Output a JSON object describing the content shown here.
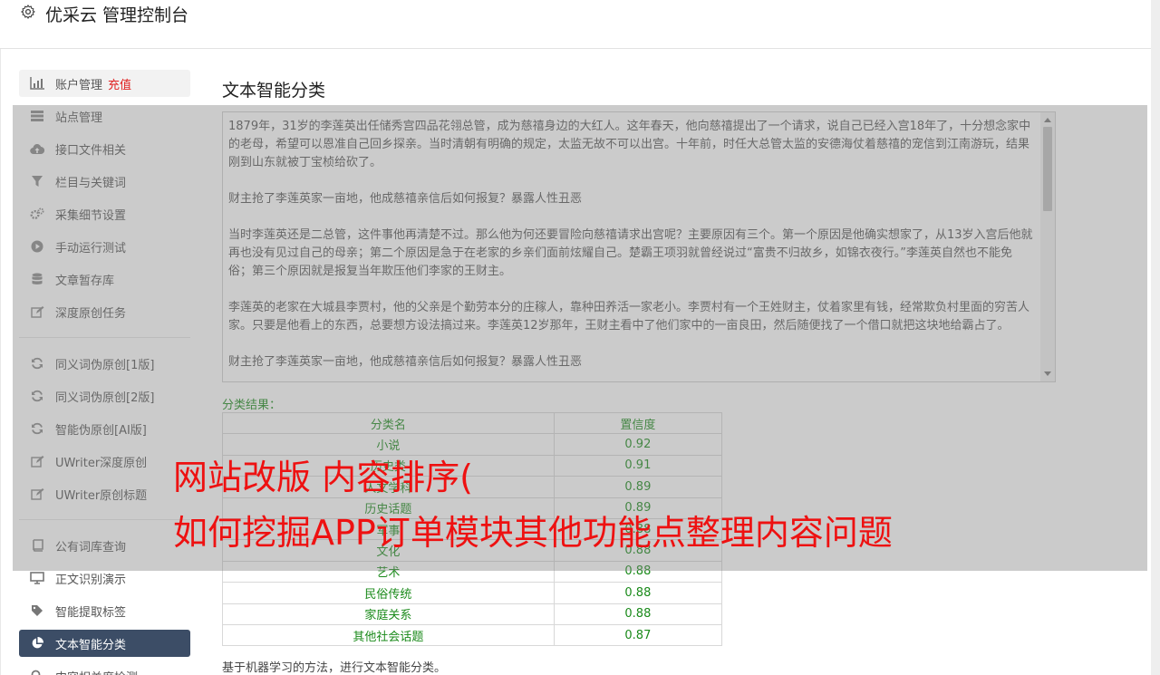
{
  "header": {
    "title": "优采云 管理控制台",
    "icon": "gear-icon"
  },
  "sidebar": {
    "items": [
      {
        "label": "账户管理",
        "extra": "充值",
        "icon": "bar-chart-icon"
      },
      {
        "label": "站点管理",
        "icon": "server-icon"
      },
      {
        "label": "接口文件相关",
        "icon": "cloud-upload-icon"
      },
      {
        "label": "栏目与关键词",
        "icon": "filter-icon"
      },
      {
        "label": "采集细节设置",
        "icon": "cogs-icon"
      },
      {
        "label": "手动运行测试",
        "icon": "play-circle-icon"
      },
      {
        "label": "文章暂存库",
        "icon": "database-icon"
      },
      {
        "label": "深度原创任务",
        "icon": "edit-icon"
      },
      {
        "label": "同义词伪原创[1版]",
        "icon": "refresh-icon"
      },
      {
        "label": "同义词伪原创[2版]",
        "icon": "refresh-icon"
      },
      {
        "label": "智能伪原创[AI版]",
        "icon": "refresh-icon"
      },
      {
        "label": "UWriter深度原创",
        "icon": "edit-icon"
      },
      {
        "label": "UWriter原创标题",
        "icon": "edit-icon"
      },
      {
        "label": "公有词库查询",
        "icon": "book-icon"
      },
      {
        "label": "正文识别演示",
        "icon": "monitor-icon"
      },
      {
        "label": "智能提取标签",
        "icon": "tag-icon"
      },
      {
        "label": "文本智能分类",
        "icon": "pie-chart-icon"
      },
      {
        "label": "内容相关度检测",
        "icon": "search-icon"
      }
    ]
  },
  "main": {
    "title": "文本智能分类",
    "paragraphs": [
      "1879年，31岁的李莲英出任储秀宫四品花翎总管，成为慈禧身边的大红人。这年春天，他向慈禧提出了一个请求，说自己已经入宫18年了，十分想念家中的老母，希望可以恩准自己回乡探亲。当时清朝有明确的规定，太监无故不可以出宫。十年前，时任大总管太监的安德海仗着慈禧的宠信到江南游玩，结果刚到山东就被丁宝桢给砍了。",
      "财主抢了李莲英家一亩地，他成慈禧亲信后如何报复？暴露人性丑恶",
      "当时李莲英还是二总管，这件事他再清楚不过。那么他为何还要冒险向慈禧请求出宫呢？主要原因有三个。第一个原因是他确实想家了，从13岁入宫后他就再也没有见过自己的母亲；第二个原因是急于在老家的乡亲们面前炫耀自己。楚霸王项羽就曾经说过“富贵不归故乡，如锦衣夜行。”李莲英自然也不能免俗；第三个原因就是报复当年欺压他们李家的王财主。",
      "李莲英的老家在大城县李贾村，他的父亲是个勤劳本分的庄稼人，靠种田养活一家老小。李贾村有一个王姓财主，仗着家里有钱，经常欺负村里面的穷苦人家。只要是他看上的东西，总要想方设法搞过来。李莲英12岁那年，王财主看中了他们家中的一亩良田，然后随便找了一个借口就把这块地给霸占了。",
      "财主抢了李莲英家一亩地，他成慈禧亲信后如何报复？暴露人性丑恶"
    ],
    "result_label": "分类结果：",
    "table": {
      "headers": [
        "分类名",
        "置信度"
      ],
      "rows": [
        [
          "小说",
          "0.92"
        ],
        [
          "历史类",
          "0.91"
        ],
        [
          "人文学科",
          "0.89"
        ],
        [
          "历史话题",
          "0.89"
        ],
        [
          "军事",
          "0.88"
        ],
        [
          "文化",
          "0.88"
        ],
        [
          "艺术",
          "0.88"
        ],
        [
          "民俗传统",
          "0.88"
        ],
        [
          "家庭关系",
          "0.88"
        ],
        [
          "其他社会话题",
          "0.87"
        ]
      ]
    },
    "note": "基于机器学习的方法，进行文本智能分类。"
  },
  "banner": {
    "line1": "网站改版 内容排序(",
    "line2": "如何挖掘APP订单模块其他功能点整理内容问题"
  }
}
